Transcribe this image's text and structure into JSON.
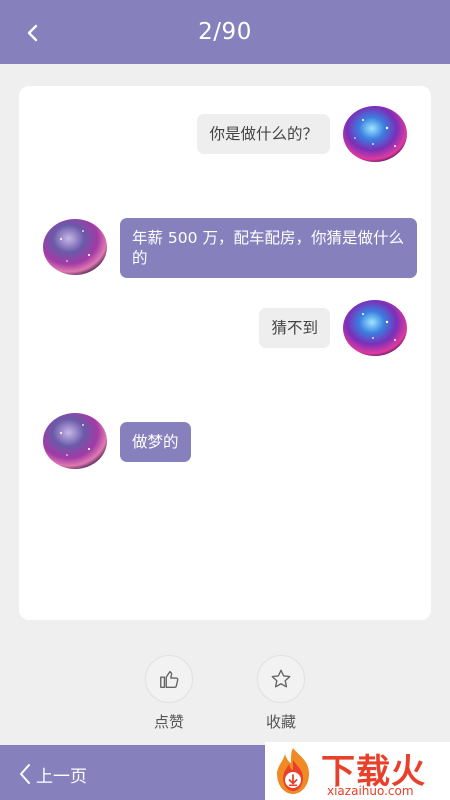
{
  "header": {
    "back_icon": "chevron-left-icon",
    "page_counter": "2/90"
  },
  "conversation": {
    "messages": [
      {
        "side": "right",
        "text": "你是做什么的？"
      },
      {
        "side": "left",
        "text": "年薪 500 万，配车配房，你猜是做什么的"
      },
      {
        "side": "right",
        "text": "猜不到"
      },
      {
        "side": "left",
        "text": "做梦的"
      }
    ]
  },
  "actions": {
    "like_label": "点赞",
    "like_icon": "thumbs-up-icon",
    "favorite_label": "收藏",
    "favorite_icon": "star-icon"
  },
  "footer": {
    "prev_label": "上一页",
    "prev_icon": "chevron-left-icon"
  },
  "watermark": {
    "title": "下载火",
    "url": "xiazaihuo.com"
  },
  "colors": {
    "accent": "#8680bd",
    "bubble_right": "#eeeeee",
    "background": "#efefef",
    "watermark": "#e8402a"
  }
}
